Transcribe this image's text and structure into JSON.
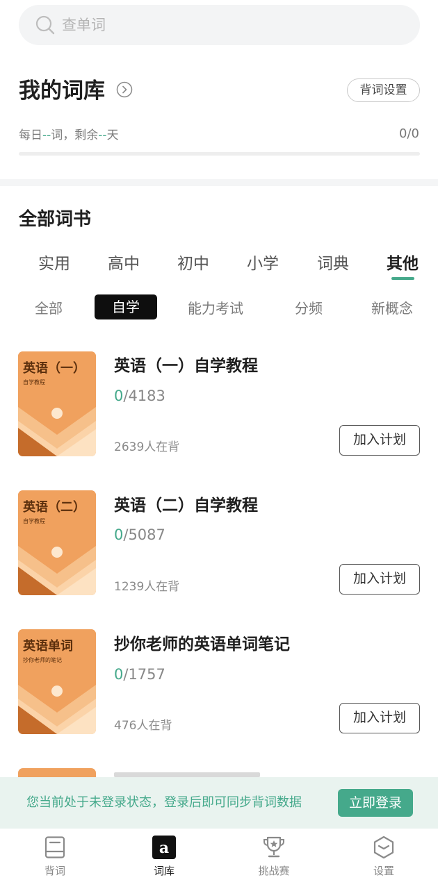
{
  "search": {
    "placeholder": "查单词",
    "icon": "search-icon"
  },
  "my_library": {
    "title": "我的词库",
    "settings_label": "背词设置",
    "daily_prefix": "每日",
    "daily_words": "--",
    "daily_mid": "词，剩余",
    "daily_days": "--",
    "daily_suffix": "天",
    "progress_text": "0/0",
    "progress_fraction": 0
  },
  "all_books": {
    "title": "全部词书",
    "category_tabs": [
      {
        "label": "实用"
      },
      {
        "label": "高中"
      },
      {
        "label": "初中"
      },
      {
        "label": "小学"
      },
      {
        "label": "词典"
      },
      {
        "label": "其他",
        "active": true
      }
    ],
    "sub_filters": [
      {
        "label": "全部"
      },
      {
        "label": "自学",
        "active": true
      },
      {
        "label": "能力考试"
      },
      {
        "label": "分频"
      },
      {
        "label": "新概念"
      }
    ]
  },
  "books": [
    {
      "cover_title": "英语（一）",
      "cover_sub": "自学教程",
      "title": "英语（一）自学教程",
      "learned": "0",
      "total": "/4183",
      "learners": "2639人在背",
      "add_label": "加入计划"
    },
    {
      "cover_title": "英语（二）",
      "cover_sub": "自学教程",
      "title": "英语（二）自学教程",
      "learned": "0",
      "total": "/5087",
      "learners": "1239人在背",
      "add_label": "加入计划"
    },
    {
      "cover_title": "英语单词",
      "cover_sub": "抄你老师的笔记",
      "title": "抄你老师的英语单词笔记",
      "learned": "0",
      "total": "/1757",
      "learners": "476人在背",
      "add_label": "加入计划"
    }
  ],
  "login_banner": {
    "text": "您当前处于未登录状态，登录后即可同步背词数据",
    "button_label": "立即登录"
  },
  "bottom_nav": [
    {
      "label": "背词",
      "icon": "book-icon"
    },
    {
      "label": "词库",
      "icon": "letter-a-icon",
      "active": true
    },
    {
      "label": "挑战赛",
      "icon": "trophy-icon"
    },
    {
      "label": "设置",
      "icon": "hexagon-settings-icon"
    }
  ],
  "colors": {
    "accent": "#45a98b",
    "cover_orange": "#f0a15e",
    "active_chip": "#0e0e0e",
    "banner_bg": "#e9f3ef"
  }
}
